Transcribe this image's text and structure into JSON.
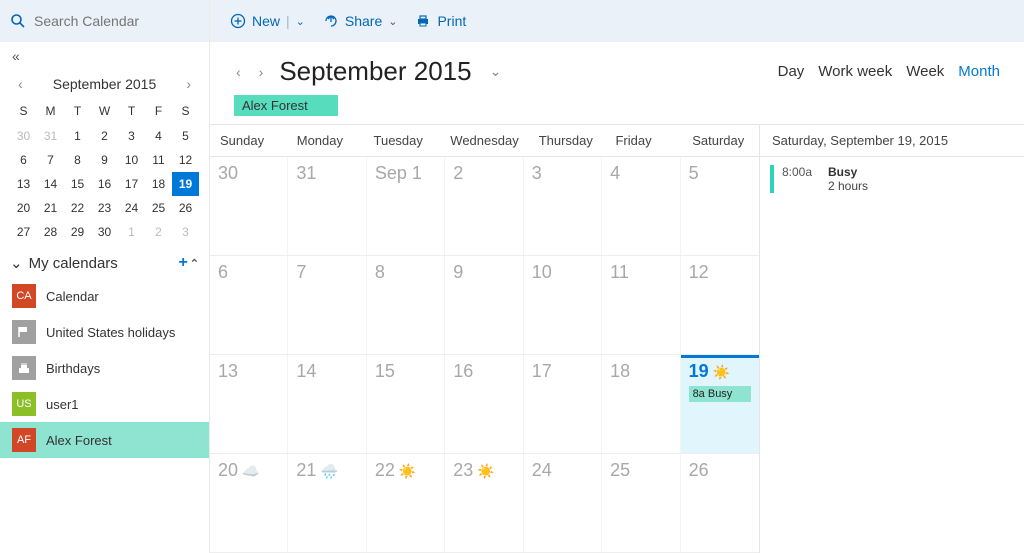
{
  "search": {
    "placeholder": "Search Calendar"
  },
  "toolbar": {
    "new": "New",
    "share": "Share",
    "print": "Print"
  },
  "header": {
    "title": "September 2015",
    "views": {
      "day": "Day",
      "workweek": "Work week",
      "week": "Week",
      "month": "Month"
    },
    "active_view": "month"
  },
  "owner": "Alex Forest",
  "mini": {
    "title": "September 2015",
    "dow": [
      "S",
      "M",
      "T",
      "W",
      "T",
      "F",
      "S"
    ],
    "days": [
      {
        "n": "30",
        "dim": true
      },
      {
        "n": "31",
        "dim": true
      },
      {
        "n": "1"
      },
      {
        "n": "2"
      },
      {
        "n": "3"
      },
      {
        "n": "4"
      },
      {
        "n": "5"
      },
      {
        "n": "6"
      },
      {
        "n": "7"
      },
      {
        "n": "8"
      },
      {
        "n": "9"
      },
      {
        "n": "10"
      },
      {
        "n": "11"
      },
      {
        "n": "12"
      },
      {
        "n": "13"
      },
      {
        "n": "14"
      },
      {
        "n": "15"
      },
      {
        "n": "16"
      },
      {
        "n": "17"
      },
      {
        "n": "18"
      },
      {
        "n": "19",
        "sel": true
      },
      {
        "n": "20"
      },
      {
        "n": "21"
      },
      {
        "n": "22"
      },
      {
        "n": "23"
      },
      {
        "n": "24"
      },
      {
        "n": "25"
      },
      {
        "n": "26"
      },
      {
        "n": "27"
      },
      {
        "n": "28"
      },
      {
        "n": "29"
      },
      {
        "n": "30"
      },
      {
        "n": "1",
        "dim": true
      },
      {
        "n": "2",
        "dim": true
      },
      {
        "n": "3",
        "dim": true
      }
    ]
  },
  "calendars": {
    "header": "My calendars",
    "items": [
      {
        "abbr": "CA",
        "label": "Calendar",
        "color": "#d24726"
      },
      {
        "abbr": "",
        "label": "United States holidays",
        "color": "#a0a0a0",
        "icon": "flag"
      },
      {
        "abbr": "",
        "label": "Birthdays",
        "color": "#a0a0a0",
        "icon": "cake"
      },
      {
        "abbr": "US",
        "label": "user1",
        "color": "#8cbf26"
      },
      {
        "abbr": "AF",
        "label": "Alex Forest",
        "color": "#d24726",
        "selected": true
      }
    ]
  },
  "month": {
    "dow": [
      "Sunday",
      "Monday",
      "Tuesday",
      "Wednesday",
      "Thursday",
      "Friday",
      "Saturday"
    ],
    "weeks": [
      [
        {
          "n": "30"
        },
        {
          "n": "31"
        },
        {
          "n": "Sep 1"
        },
        {
          "n": "2"
        },
        {
          "n": "3"
        },
        {
          "n": "4"
        },
        {
          "n": "5"
        }
      ],
      [
        {
          "n": "6"
        },
        {
          "n": "7"
        },
        {
          "n": "8"
        },
        {
          "n": "9"
        },
        {
          "n": "10"
        },
        {
          "n": "11"
        },
        {
          "n": "12"
        }
      ],
      [
        {
          "n": "13"
        },
        {
          "n": "14"
        },
        {
          "n": "15"
        },
        {
          "n": "16"
        },
        {
          "n": "17"
        },
        {
          "n": "18"
        },
        {
          "n": "19",
          "sel": true,
          "w": "☀️",
          "event": "8a Busy"
        }
      ],
      [
        {
          "n": "20",
          "w": "☁️"
        },
        {
          "n": "21",
          "w": "🌧️"
        },
        {
          "n": "22",
          "w": "☀️"
        },
        {
          "n": "23",
          "w": "☀️"
        },
        {
          "n": "24"
        },
        {
          "n": "25"
        },
        {
          "n": "26"
        }
      ]
    ]
  },
  "daypane": {
    "title": "Saturday, September 19, 2015",
    "items": [
      {
        "time": "8:00a",
        "title": "Busy",
        "sub": "2 hours"
      }
    ]
  }
}
